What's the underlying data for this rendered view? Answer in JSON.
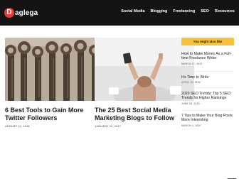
{
  "header": {
    "logo_letter": "D",
    "logo_text": "aglega",
    "nav": [
      "Social Media",
      "Blogging",
      "Freelancing",
      "SEO",
      "Resources"
    ]
  },
  "posts": [
    {
      "title": "6 Best Tools to Gain More Twitter Followers",
      "date": "AUGUST 11, 2018",
      "image_icon": "wrenches-photo"
    },
    {
      "title": "The 25 Best Social Media Marketing Blogs to Follow",
      "date": "JANUARY 20, 2017",
      "image_icon": "phone-in-bed-photo"
    }
  ],
  "sidebar": {
    "heading": "You might also like",
    "items": [
      {
        "title": "How to Make Money As a Full-time Freelance Writer",
        "date": "MARCH 27, 2020"
      },
      {
        "title": "It's Time to Write",
        "date": "APRIL 15, 2020"
      },
      {
        "title": "2020 SEO Trends: Top 5 SEO Trends for Higher Rankings",
        "date": "JUNE 25, 2020"
      },
      {
        "title": "7 Tips to Make Your Blog Posts More Interesting",
        "date": "MARCH 4, 2020"
      }
    ]
  },
  "colors": {
    "topbar": "#141414",
    "accent": "#f6c23a",
    "logo": "#e63b3b"
  }
}
